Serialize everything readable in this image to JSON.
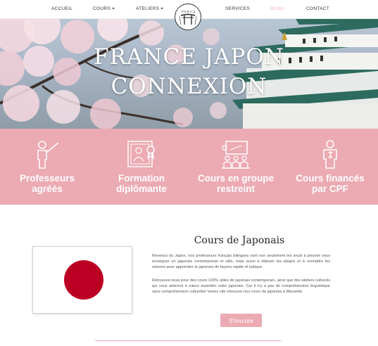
{
  "nav": {
    "items": [
      {
        "label": "ACCUEIL"
      },
      {
        "label": "COURS"
      },
      {
        "label": "ATELIERS"
      },
      {
        "label": "SERVICES"
      },
      {
        "label": "BLOG"
      },
      {
        "label": "CONTACT"
      }
    ],
    "logo_text": "マルセイユ"
  },
  "hero": {
    "title_line1": "FRANCE JAPON",
    "title_line2": "CONNEXION"
  },
  "features": [
    {
      "label": "Professeurs\nagréés",
      "icon": "teacher-icon"
    },
    {
      "label": "Formation\ndiplômante",
      "icon": "diploma-icon"
    },
    {
      "label": "Cours en groupe\nrestreint",
      "icon": "classroom-icon"
    },
    {
      "label": "Cours financés\npar CPF",
      "icon": "funding-icon"
    }
  ],
  "cours": {
    "title": "Cours de Japonais",
    "paragraph1": "Revenus du Japon, nos professeurs français bilingues sont non seulement les seuls à pouvoir vous enseigner un japonais contemporain et utile, mais aussi à déjouer les pièges et à connaître les astuces  pour apprendre le japonais de façons rapide et ludique.",
    "paragraph2": "Retrouvez-nous pour des cours 100% utiles de japonais contemporain, ainsi que des ateliers culturels qui vous aideront à mieux assimiler votre japonais. Car il n'y a pas de compréhension linguistique sans compréhension culturelle! Venez vite retrouver nos cours de japonais à Marseille.",
    "button": "S'inscrire"
  },
  "colors": {
    "accent": "#ecaab3",
    "flag_red": "#bc0023"
  }
}
